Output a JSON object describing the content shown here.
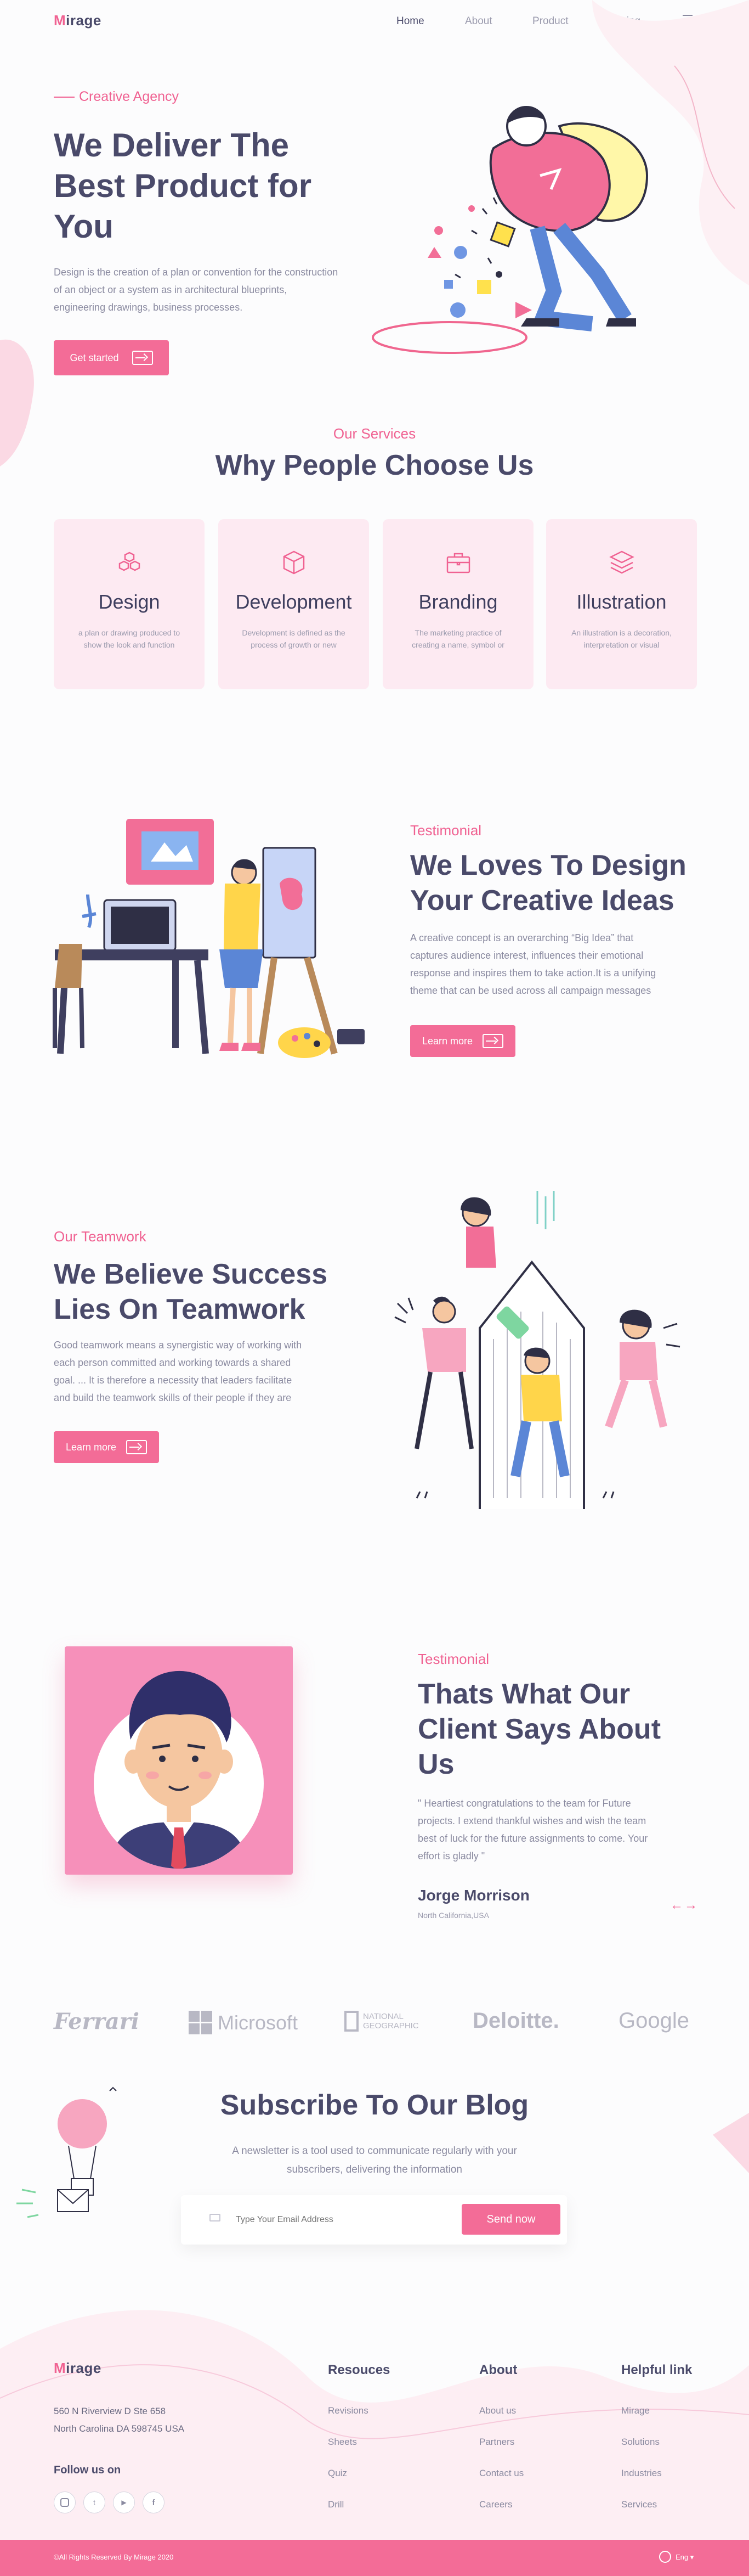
{
  "nav": {
    "logo": "Mirage",
    "links": [
      "Home",
      "About",
      "Product",
      "Pricing"
    ]
  },
  "hero": {
    "eyebrow": "Creative Agency",
    "title_lines": [
      "We Deliver The",
      "Best Product for",
      "You"
    ],
    "description_lines": [
      "Design is the creation of a plan or convention for the construction",
      "of an object or a system as in architectural blueprints,",
      "engineering drawings, business processes."
    ],
    "cta": "Get started"
  },
  "services": {
    "eyebrow": "Our Services",
    "title": "Why People Choose Us",
    "cards": [
      {
        "title": "Design",
        "icon": "cubes-icon",
        "desc": "a plan or drawing produced to show the look and function"
      },
      {
        "title": "Development",
        "icon": "cube-icon",
        "desc": "Development is defined as the process of growth or new"
      },
      {
        "title": "Branding",
        "icon": "briefcase-icon",
        "desc": "The marketing practice of creating a name, symbol or"
      },
      {
        "title": "Illustration",
        "icon": "layers-icon",
        "desc": "An illustration is a decoration, interpretation or visual"
      }
    ]
  },
  "creative": {
    "eyebrow": "Testimonial",
    "title_lines": [
      "We Loves To Design",
      "Your Creative Ideas"
    ],
    "description_lines": [
      "A creative concept is an overarching “Big Idea” that",
      "captures audience interest, influences their emotional",
      "response and inspires them to take action.It is a unifying",
      "theme that can be used across all campaign messages"
    ],
    "cta": "Learn more"
  },
  "teamwork": {
    "eyebrow": "Our Teamwork",
    "title_lines": [
      "We Believe Success",
      "Lies On Teamwork"
    ],
    "description_lines": [
      "Good teamwork means a synergistic way of working with",
      "each person committed and working towards a shared",
      "goal. ... It is therefore a necessity that leaders facilitate",
      "and build the teamwork skills of their people if they are"
    ],
    "cta": "Learn more"
  },
  "testimonial": {
    "eyebrow": "Testimonial",
    "title_lines": [
      "Thats What Our",
      "Client Says About",
      "Us"
    ],
    "quote_lines": [
      "\" Heartiest congratulations to the team for Future",
      "projects. I extend thankful wishes and wish the team",
      "best of luck for the future assignments to come. Your",
      "effort is gladly \""
    ],
    "name": "Jorge Morrison",
    "location": "North California,USA"
  },
  "brands": [
    "Ferrari",
    "Microsoft",
    "NATIONAL GEOGRAPHIC",
    "Deloitte.",
    "Google"
  ],
  "subscribe": {
    "title": "Subscribe To Our Blog",
    "description_lines": [
      "A newsletter is a tool used to communicate regularly with your",
      "subscribers, delivering the information"
    ],
    "placeholder": "Type Your Email Address",
    "button": "Send now"
  },
  "footer": {
    "logo": "Mirage",
    "address_lines": [
      "560 N Riverview D Ste 658",
      "North Carolina DA 598745 USA"
    ],
    "follow": "Follow us on",
    "columns": [
      {
        "title": "Resouces",
        "links": [
          "Revisions",
          "Sheets",
          "Quiz",
          "Drill"
        ]
      },
      {
        "title": "About",
        "links": [
          "About us",
          "Partners",
          "Contact us",
          "Careers"
        ]
      },
      {
        "title": "Helpful link",
        "links": [
          "Mirage",
          "Solutions",
          "Industries",
          "Services"
        ]
      }
    ],
    "copyright": "©All Rights Reserved By Mirage 2020",
    "language": "Eng"
  },
  "colors": {
    "accent": "#f36c97",
    "text": "#4a4a6a",
    "muted": "#8a8aa0",
    "card": "#fdeaf2"
  }
}
